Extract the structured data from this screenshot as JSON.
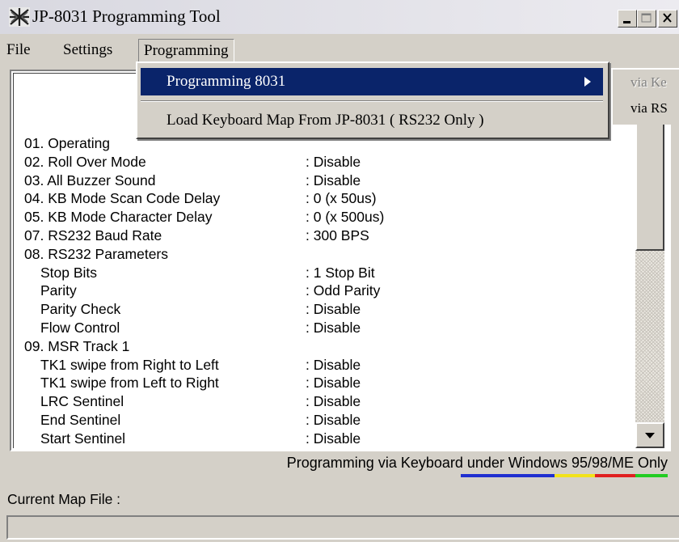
{
  "window": {
    "title": "JP-8031 Programming Tool"
  },
  "menubar": {
    "file": "File",
    "settings": "Settings",
    "programming": "Programming"
  },
  "dropdown": {
    "item1": "Programming 8031",
    "item2": "Load Keyboard Map From JP-8031 ( RS232 Only )"
  },
  "submenu": {
    "item1": "via Ke",
    "item2": "via RS"
  },
  "settings_list": [
    {
      "label": "01.  Operating",
      "value": ""
    },
    {
      "label": "02.  Roll Over Mode",
      "value": ":  Disable"
    },
    {
      "label": "03.  All Buzzer Sound",
      "value": ":  Disable"
    },
    {
      "label": "04.  KB Mode Scan Code Delay",
      "value": ":  0 (x 50us)"
    },
    {
      "label": "05.  KB Mode Character Delay",
      "value": ":  0 (x 500us)"
    },
    {
      "label": "07.  RS232 Baud Rate",
      "value": ":  300 BPS"
    },
    {
      "label": "08.  RS232 Parameters",
      "value": ""
    },
    {
      "label": "Stop Bits",
      "value": ":  1 Stop Bit"
    },
    {
      "label": "Parity",
      "value": ":  Odd Parity"
    },
    {
      "label": "Parity Check",
      "value": ":  Disable"
    },
    {
      "label": "Flow Control",
      "value": ":  Disable"
    },
    {
      "label": "09.  MSR Track 1",
      "value": ""
    },
    {
      "label": "TK1 swipe from Right to Left",
      "value": ":  Disable"
    },
    {
      "label": "TK1 swipe from Left to Right",
      "value": ":  Disable"
    },
    {
      "label": "LRC Sentinel",
      "value": ":  Disable"
    },
    {
      "label": "End Sentinel",
      "value": ":  Disable"
    },
    {
      "label": "Start Sentinel",
      "value": ":  Disable"
    }
  ],
  "status_message": "Programming via Keyboard under Windows 95/98/ME Only",
  "map_label": "Current Map File :",
  "colors": {
    "selection": "#0a246a",
    "bar_blue": "#1f2fd0",
    "bar_yellow": "#f2e21a",
    "bar_red": "#e02020",
    "bar_green": "#22cc22"
  },
  "icons": {
    "app": "windows-flag-icon",
    "minimize": "minimize-icon",
    "maximize": "maximize-icon",
    "close": "close-icon",
    "submenu_arrow": "right-arrow-icon",
    "scroll_down": "down-arrow-icon"
  }
}
